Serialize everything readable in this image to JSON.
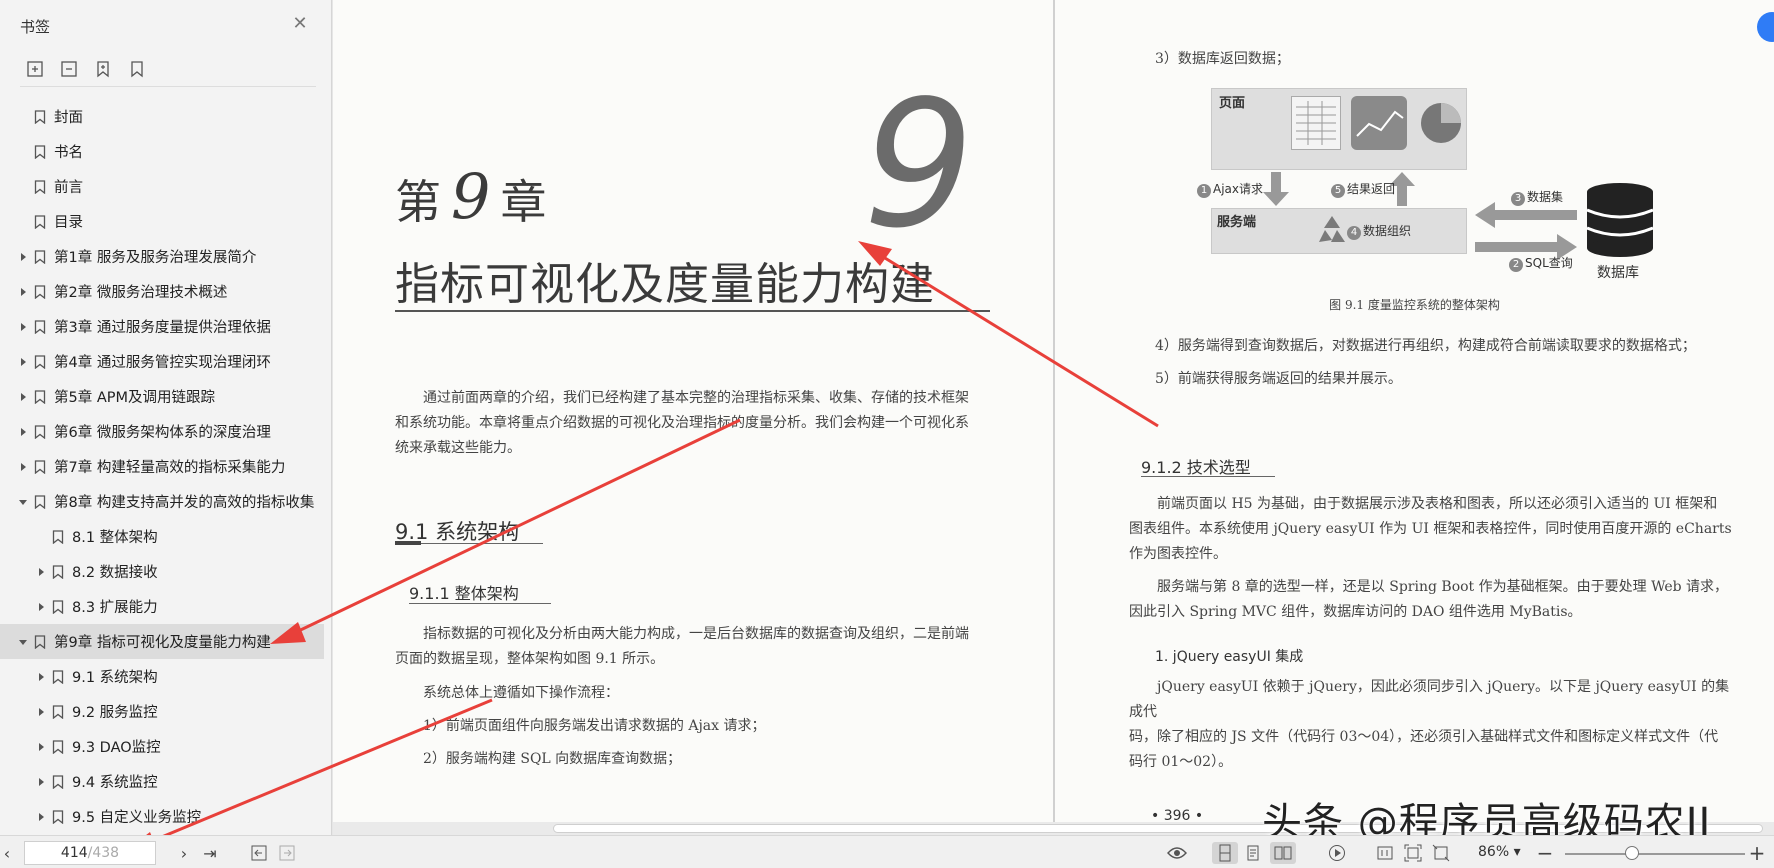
{
  "sidebar": {
    "title": "书签",
    "items": [
      {
        "label": "封面",
        "level": 0,
        "expand": "none"
      },
      {
        "label": "书名",
        "level": 0,
        "expand": "none"
      },
      {
        "label": "前言",
        "level": 0,
        "expand": "none"
      },
      {
        "label": "目录",
        "level": 0,
        "expand": "none"
      },
      {
        "label": "第1章 服务及服务治理发展简介",
        "level": 0,
        "expand": "collapsed"
      },
      {
        "label": "第2章 微服务治理技术概述",
        "level": 0,
        "expand": "collapsed"
      },
      {
        "label": "第3章 通过服务度量提供治理依据",
        "level": 0,
        "expand": "collapsed"
      },
      {
        "label": "第4章 通过服务管控实现治理闭环",
        "level": 0,
        "expand": "collapsed"
      },
      {
        "label": "第5章 APM及调用链跟踪",
        "level": 0,
        "expand": "collapsed"
      },
      {
        "label": "第6章 微服务架构体系的深度治理",
        "level": 0,
        "expand": "collapsed"
      },
      {
        "label": "第7章 构建轻量高效的指标采集能力",
        "level": 0,
        "expand": "collapsed"
      },
      {
        "label": "第8章 构建支持高并发的高效的指标收集",
        "level": 0,
        "expand": "expanded"
      },
      {
        "label": "8.1 整体架构",
        "level": 1,
        "expand": "none"
      },
      {
        "label": "8.2 数据接收",
        "level": 1,
        "expand": "collapsed"
      },
      {
        "label": "8.3 扩展能力",
        "level": 1,
        "expand": "collapsed"
      },
      {
        "label": "第9章 指标可视化及度量能力构建",
        "level": 0,
        "expand": "expanded",
        "active": true
      },
      {
        "label": "9.1 系统架构",
        "level": 1,
        "expand": "collapsed"
      },
      {
        "label": "9.2 服务监控",
        "level": 1,
        "expand": "collapsed"
      },
      {
        "label": "9.3 DAO监控",
        "level": 1,
        "expand": "collapsed"
      },
      {
        "label": "9.4 系统监控",
        "level": 1,
        "expand": "collapsed"
      },
      {
        "label": "9.5 自定义业务监控",
        "level": 1,
        "expand": "collapsed"
      }
    ]
  },
  "left_page": {
    "chapter_prefix": "第",
    "chapter_number": "9",
    "chapter_suffix": "章",
    "chapter_big_number": "9",
    "chapter_title": "指标可视化及度量能力构建",
    "intro_1": "通过前面两章的介绍，我们已经构建了基本完整的治理指标采集、收集、存储的技术框架",
    "intro_2": "和系统功能。本章将重点介绍数据的可视化及治理指标的度量分析。我们会构建一个可视化系",
    "intro_3": "统来承载这些能力。",
    "section_9_1": "9.1   系统架构",
    "section_9_1_1": "9.1.1   整体架构",
    "body_1": "指标数据的可视化及分析由两大能力构成，一是后台数据库的数据查询及组织，二是前端",
    "body_2": "页面的数据呈现，整体架构如图 9.1 所示。",
    "body_3": "系统总体上遵循如下操作流程：",
    "step_1": "1）前端页面组件向服务端发出请求数据的 Ajax 请求；",
    "step_2": "2）服务端构建 SQL 向数据库查询数据；"
  },
  "right_page": {
    "step_3": "3）数据库返回数据；",
    "figure": {
      "page_label": "页面",
      "server_label": "服务端",
      "db_label": "数据库",
      "ajax": "Ajax请求",
      "result_return": "结果返回",
      "data_set": "数据集",
      "sql_query": "SQL查询",
      "data_org": "数据组织",
      "n1": "1",
      "n2": "2",
      "n3": "3",
      "n4": "4",
      "n5": "5"
    },
    "caption": "图 9.1    度量监控系统的整体架构",
    "step_4": "4）服务端得到查询数据后，对数据进行再组织，构建成符合前端读取要求的数据格式；",
    "step_5": "5）前端获得服务端返回的结果并展示。",
    "section_9_1_2": "9.1.2   技术选型",
    "tech_1": "前端页面以 H5 为基础，由于数据展示涉及表格和图表，所以还必须引入适当的 UI 框架和",
    "tech_2": "图表组件。本系统使用 jQuery easyUI 作为 UI 框架和表格控件，同时使用百度开源的 eCharts",
    "tech_3": "作为图表控件。",
    "tech_4": "服务端与第 8 章的选型一样，还是以 Spring  Boot 作为基础框架。由于要处理 Web 请求，",
    "tech_5": "因此引入 Spring MVC 组件，数据库访问的 DAO 组件选用 MyBatis。",
    "sub_1": "1.  jQuery easyUI 集成",
    "jq_1": "jQuery easyUI 依赖于 jQuery，因此必须同步引入 jQuery。以下是 jQuery easyUI 的集成代",
    "jq_2": "码，除了相应的 JS 文件（代码行 03～04），还必须引入基础样式文件和图标定义样式文件（代",
    "jq_3": "码行 01～02）。",
    "page_number": "•   396   •"
  },
  "watermark": "头条 @程序员高级码农II",
  "bottombar": {
    "current_page": "414",
    "total_pages": "/438",
    "zoom": "86%",
    "zoom_level": 0.37
  },
  "colors": {
    "annotation_red": "#e8403a",
    "accent_blue": "#2f7cf6"
  }
}
